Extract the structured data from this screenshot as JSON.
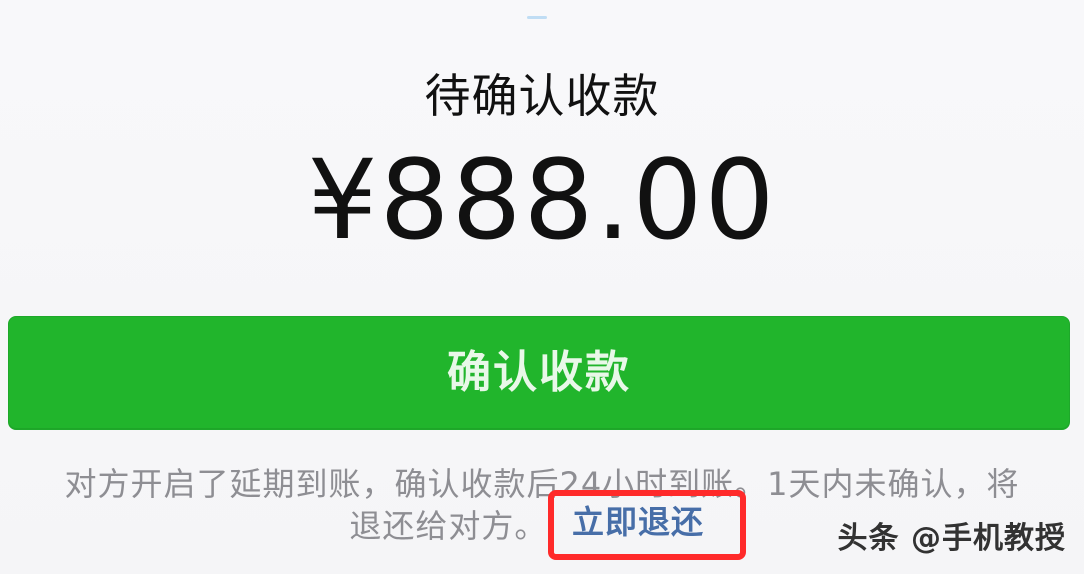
{
  "payment": {
    "status_title": "待确认收款",
    "amount": "¥888.00"
  },
  "actions": {
    "confirm_button": "确认收款",
    "refund_link": "立即退还"
  },
  "notice": {
    "line1": "对方开启了延期到账，确认收款后24小时到账。1天内未确认，将",
    "line2_prefix": "退还给对方。"
  },
  "overlay": {
    "watermark": "头条 @手机教授"
  },
  "colors": {
    "primary_green": "#21b52c",
    "link_blue": "#476ea8",
    "highlight_red": "#ff2a2a"
  }
}
